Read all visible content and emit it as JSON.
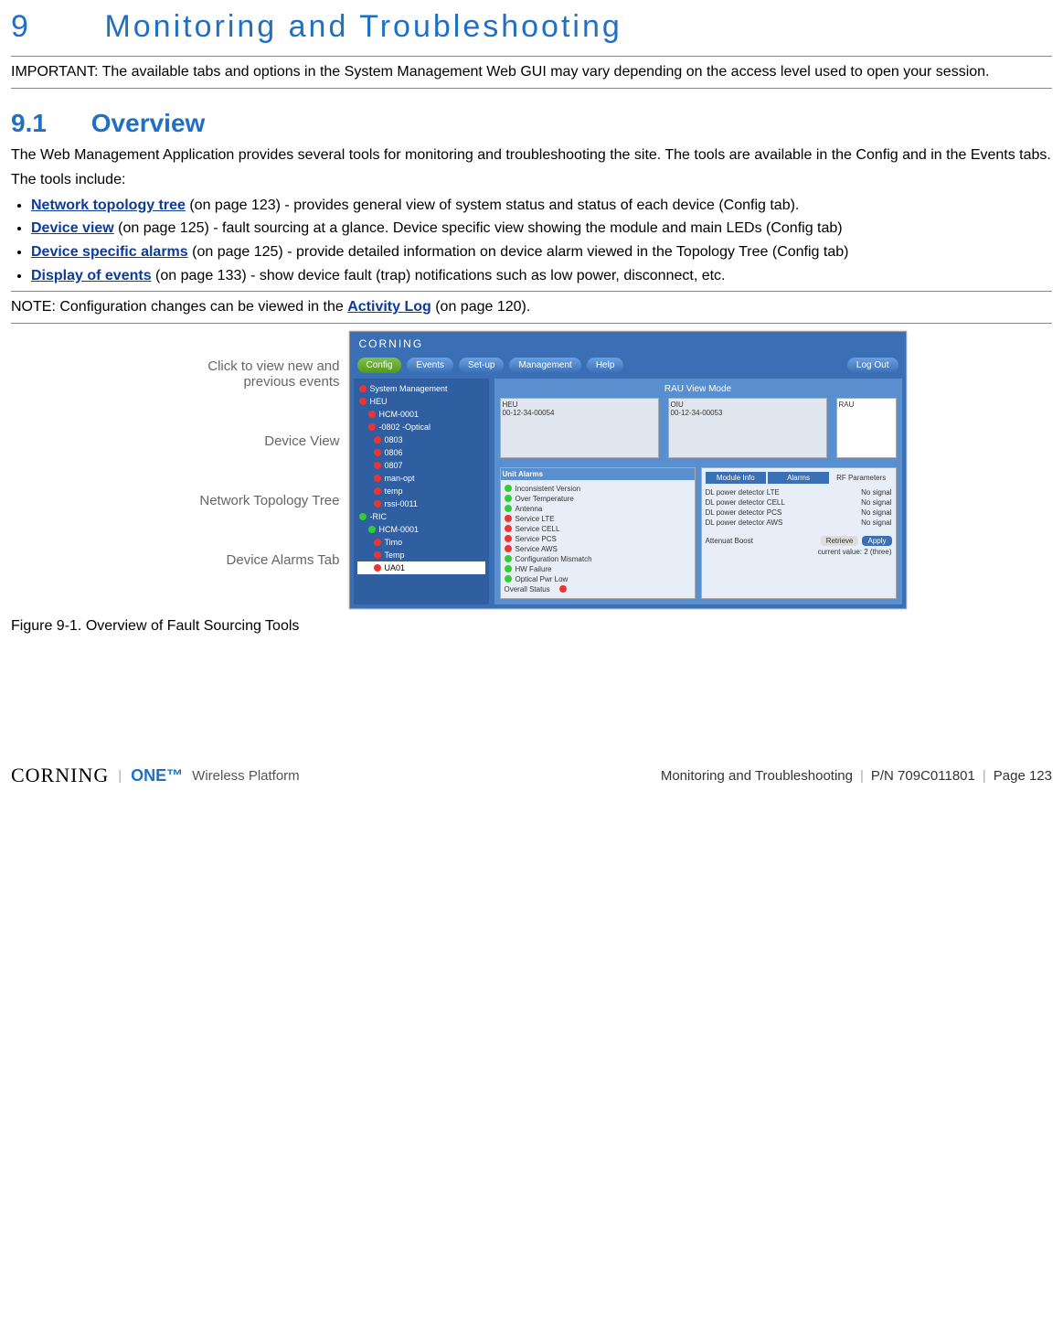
{
  "chapter": {
    "number": "9",
    "title": "Monitoring and Troubleshooting"
  },
  "important": "IMPORTANT: The available tabs and options in the System Management Web GUI may vary depending on the access level used to open your session.",
  "section": {
    "number": "9.1",
    "title": "Overview"
  },
  "overview_p1": "The Web Management Application provides several tools for monitoring and troubleshooting the site. The tools are available in the Config and in the Events tabs.",
  "overview_p2": "The tools include:",
  "tools": [
    {
      "link": "Network topology tree",
      "rest": " (on page 123) - provides general view of system status and status of each device (Config tab)."
    },
    {
      "link": "Device view",
      "rest": " (on page 125) - fault sourcing at a glance. Device specific view showing the module and main LEDs (Config tab)"
    },
    {
      "link": "Device specific alarms",
      "rest": " (on page 125) - provide detailed information on device alarm viewed in the Topology Tree (Config tab)"
    },
    {
      "link": "Display of events",
      "rest": " (on page 133) - show device fault (trap) notifications such as low power, disconnect, etc."
    }
  ],
  "note_pre": "NOTE: Configuration changes can be viewed in the ",
  "note_link": "Activity Log",
  "note_post": " (on page 120).",
  "callouts": {
    "events": "Click to view new and previous events",
    "device_view": "Device View",
    "tree": "Network Topology Tree",
    "alarms": "Device Alarms Tab"
  },
  "gui": {
    "logo": "CORNING",
    "tabs": [
      "Config",
      "Events",
      "Set-up",
      "Management",
      "Help"
    ],
    "logout": "Log Out",
    "banner": "RAU View Mode",
    "devices": {
      "heu": "HEU",
      "heu_mac": "00-12-34-00054",
      "oiu": "OIU",
      "oiu_mac": "00-12-34-00053",
      "rau": "RAU"
    },
    "tree_items": [
      "System Management",
      "HEU",
      "HCM-0001",
      "-0802 -Optical",
      "0803",
      "0806",
      "0807",
      "man-opt",
      "temp",
      "rssi-0011",
      "-RIC",
      "HCM-0001",
      "Timo",
      "Temp",
      "UA01"
    ],
    "alarms_title": "Unit Alarms",
    "alarms": [
      {
        "c": "green",
        "t": "Inconsistent Version"
      },
      {
        "c": "green",
        "t": "Over Temperature"
      },
      {
        "c": "green",
        "t": "Antenna"
      },
      {
        "c": "red",
        "t": "Service LTE"
      },
      {
        "c": "red",
        "t": "Service CELL"
      },
      {
        "c": "red",
        "t": "Service PCS"
      },
      {
        "c": "red",
        "t": "Service AWS"
      },
      {
        "c": "green",
        "t": "Configuration Mismatch"
      },
      {
        "c": "green",
        "t": "HW Failure"
      },
      {
        "c": "green",
        "t": "Optical Pwr Low"
      }
    ],
    "overall": "Overall Status",
    "right_tabs": [
      "Module Info",
      "Alarms",
      "RF Parameters"
    ],
    "rf_rows": [
      {
        "l": "DL power detector LTE",
        "v": "No signal"
      },
      {
        "l": "DL power detector CELL",
        "v": "No signal"
      },
      {
        "l": "DL power detector PCS",
        "v": "No signal"
      },
      {
        "l": "DL power detector AWS",
        "v": "No signal"
      }
    ],
    "atten": {
      "label": "Attenuat Boost",
      "btn1": "Retrieve",
      "btn2": "Apply",
      "note": "current value: 2 (three)"
    }
  },
  "figure_caption": "Figure 9-1. Overview of Fault Sourcing Tools",
  "footer": {
    "brand_corning": "CORNING",
    "brand_one": "ONE™",
    "brand_tag": "Wireless Platform",
    "doc": "Monitoring and Troubleshooting",
    "pn": "P/N 709C011801",
    "page": "Page 123"
  }
}
